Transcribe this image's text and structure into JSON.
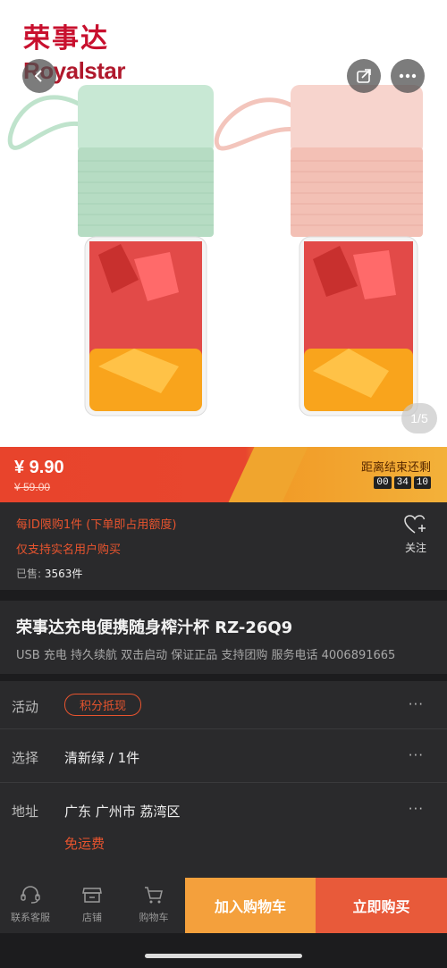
{
  "brand": {
    "name_cn": "荣事达",
    "name_en": "Royalstar"
  },
  "gallery": {
    "page_indicator": "1/5"
  },
  "price": {
    "current": "¥ 9.90",
    "original": "¥ 59.00",
    "countdown_label": "距离结束还剩",
    "countdown": [
      "00",
      "34",
      "10"
    ]
  },
  "notice": {
    "limit": "每ID限购1件 (下单即占用额度)",
    "realname": "仅支持实名用户购买",
    "sold_label": "已售:",
    "sold_count": "3563件",
    "follow_label": "关注"
  },
  "product": {
    "title": "荣事达充电便携随身榨汁杯 RZ-26Q9",
    "subtitle": "USB 充电 持久续航  双击启动 保证正品 支持团购 服务电话 4006891665"
  },
  "rows": {
    "activity_key": "活动",
    "activity_tag": "积分抵现",
    "select_key": "选择",
    "select_value": "清新绿 / 1件",
    "address_key": "地址",
    "address_value": "广东 广州市 荔湾区",
    "shipping": "免运费",
    "more": "···"
  },
  "bottom": {
    "service": "联系客服",
    "store": "店铺",
    "cart": "购物车",
    "add_cart": "加入购物车",
    "buy_now": "立即购买"
  },
  "colors": {
    "accent_red": "#e8542e",
    "accent_orange": "#f4a03c",
    "bottle_green": "#bfe3cc",
    "bottle_pink": "#f5c9c0"
  }
}
